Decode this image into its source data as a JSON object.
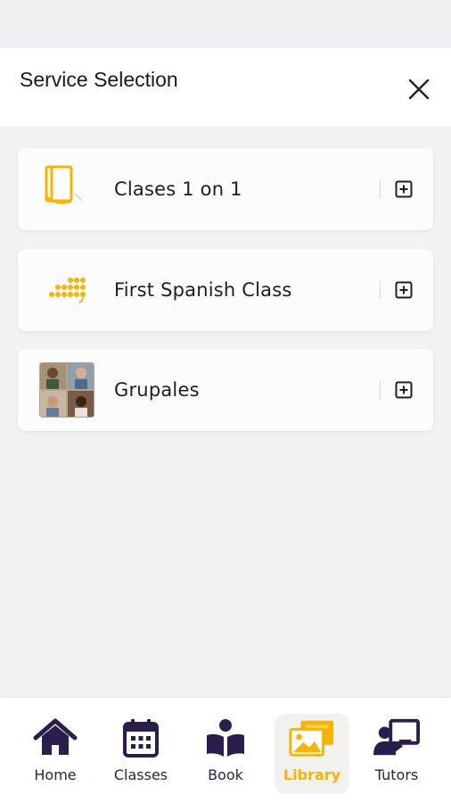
{
  "header": {
    "title": "Service Selection"
  },
  "services": [
    {
      "label": "Clases 1 on 1",
      "icon": "book-outline-icon"
    },
    {
      "label": "First Spanish Class",
      "icon": "dots-grid-icon"
    },
    {
      "label": "Grupales",
      "icon": "group-photo-thumbnail"
    }
  ],
  "tabs": [
    {
      "label": "Home",
      "icon": "home-icon"
    },
    {
      "label": "Classes",
      "icon": "calendar-icon"
    },
    {
      "label": "Book",
      "icon": "book-reader-icon"
    },
    {
      "label": "Library",
      "icon": "gallery-icon",
      "active": true
    },
    {
      "label": "Tutors",
      "icon": "tutor-board-icon"
    }
  ],
  "colors": {
    "accent": "#f7b500",
    "dark": "#2a1f4a",
    "background": "#f2f2f0"
  }
}
